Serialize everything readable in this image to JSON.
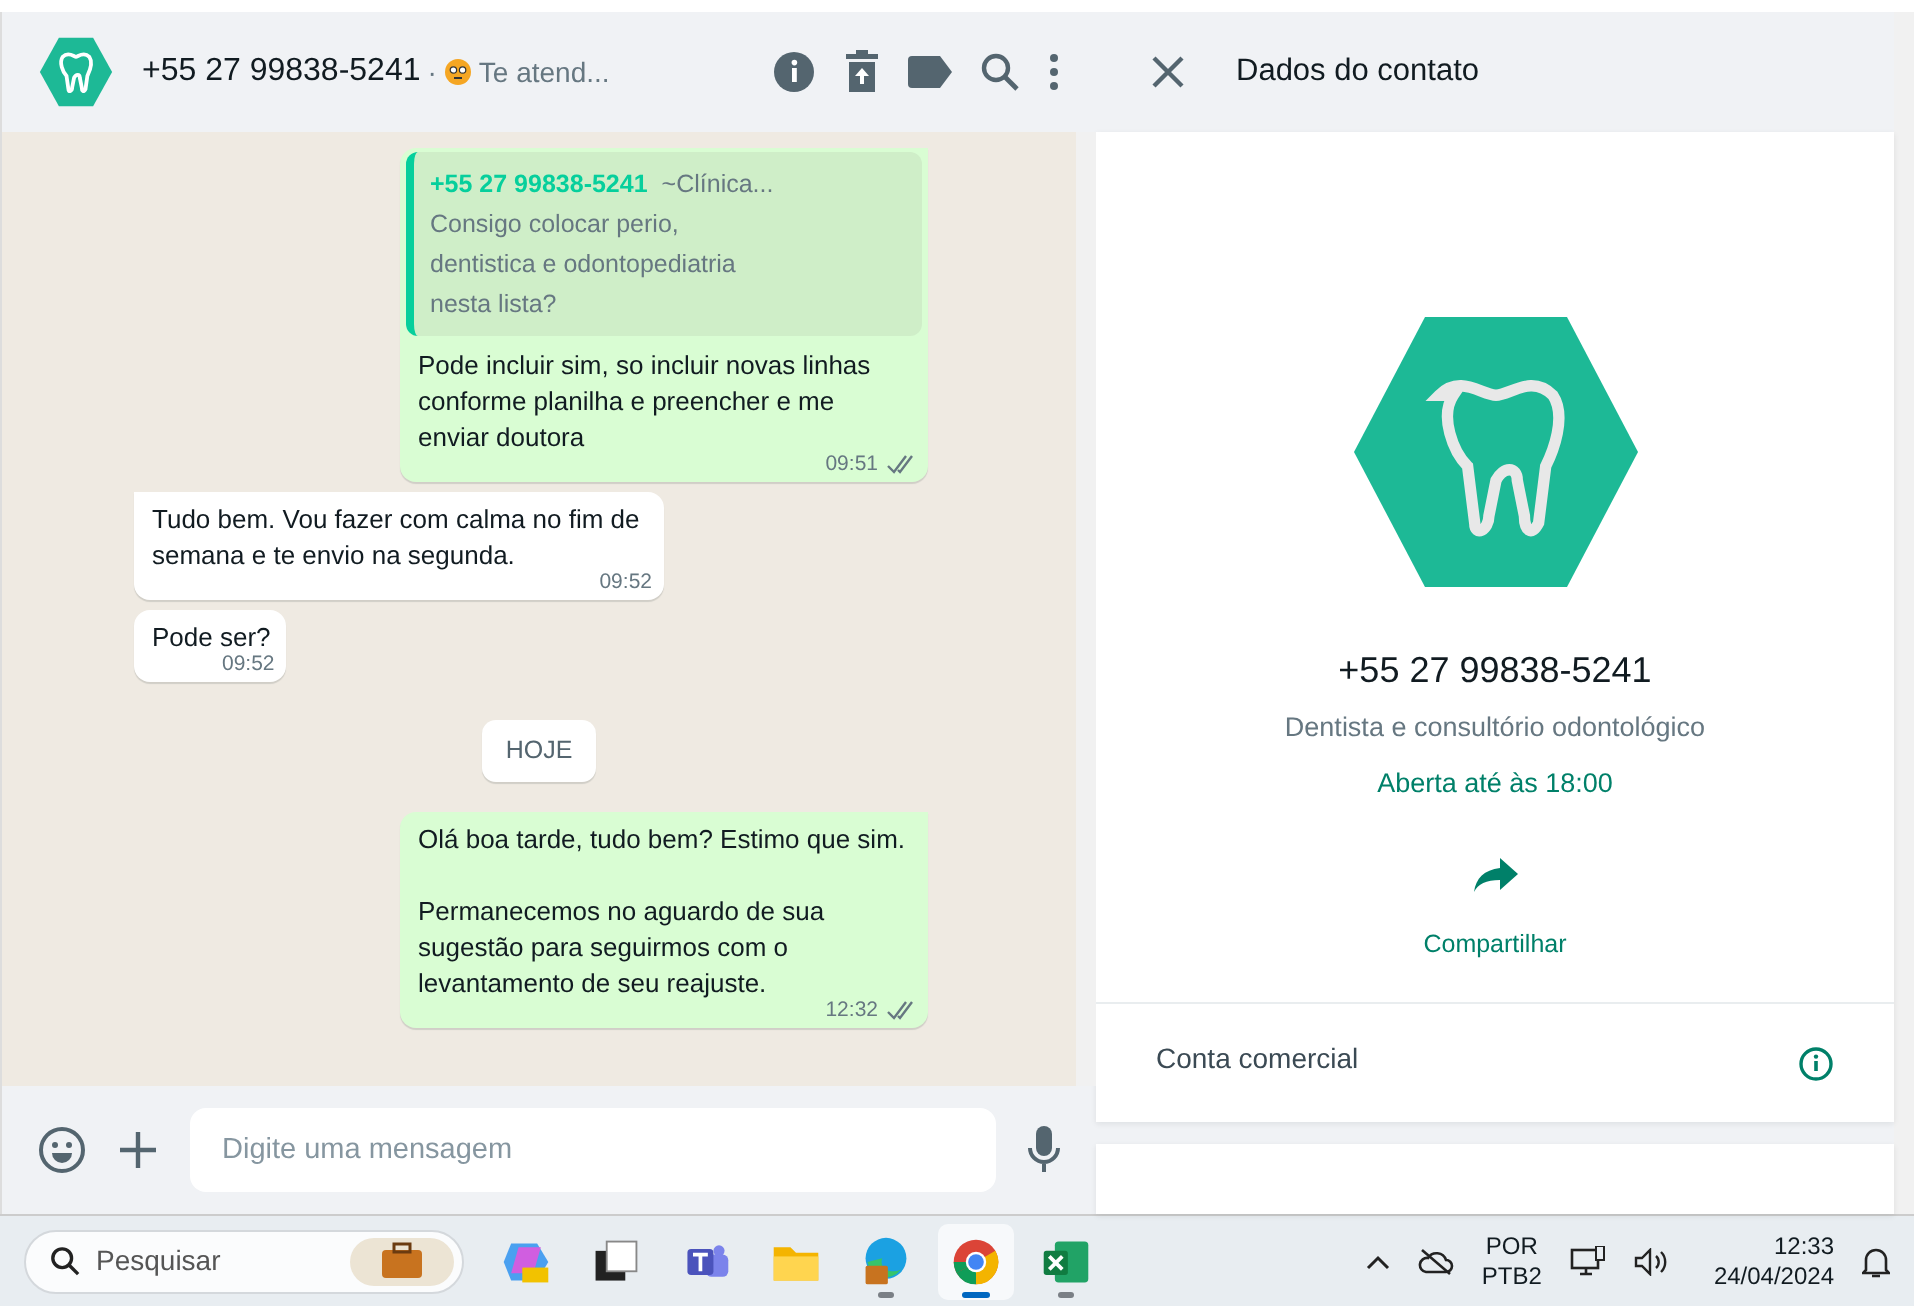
{
  "chat_header": {
    "title": "+55 27 99838-5241",
    "separator": "·",
    "status": "Te atend..."
  },
  "messages": [
    {
      "kind": "outgoing",
      "quote": {
        "author": "+55 27 99838-5241",
        "author_note": "~Clínica...",
        "text": "Consigo colocar perio,\ndentistica e odontopediatria\nnesta lista?"
      },
      "text": "Pode incluir sim, so incluir novas linhas conforme planilha e preencher e me enviar doutora",
      "time": "09:51",
      "tail": true
    },
    {
      "kind": "incoming",
      "text": "Tudo bem. Vou fazer com calma no fim de semana e te envio na segunda.",
      "time": "09:52",
      "tail": true
    },
    {
      "kind": "incoming",
      "text": "Pode ser?",
      "time": "09:52",
      "tail": false
    },
    {
      "kind": "date",
      "text": "HOJE"
    },
    {
      "kind": "outgoing",
      "text": "Olá boa tarde, tudo bem? Estimo que sim.\n\nPermanecemos no aguardo de sua sugestão para seguirmos com o levantamento de seu reajuste.",
      "time": "12:32",
      "tail": true
    }
  ],
  "composer": {
    "placeholder": "Digite uma mensagem"
  },
  "contact_panel": {
    "title": "Dados do contato",
    "name": "+55 27 99838-5241",
    "category": "Dentista e consultório odontológico",
    "hours": "Aberta até às 18:00",
    "share": "Compartilhar",
    "account_type": "Conta comercial"
  },
  "taskbar": {
    "search_placeholder": "Pesquisar",
    "apps": [
      {
        "kind": "copilot",
        "running": false,
        "selected": false
      },
      {
        "kind": "taskview",
        "running": false,
        "selected": false
      },
      {
        "kind": "teams",
        "running": false,
        "selected": false
      },
      {
        "kind": "explorer",
        "running": false,
        "selected": false
      },
      {
        "kind": "edge",
        "running": true,
        "selected": false
      },
      {
        "kind": "chrome",
        "running": true,
        "selected": true
      },
      {
        "kind": "excel",
        "running": true,
        "selected": false
      }
    ],
    "language": "POR",
    "layout": "PTB2",
    "time": "12:33",
    "date": "24/04/2024"
  }
}
